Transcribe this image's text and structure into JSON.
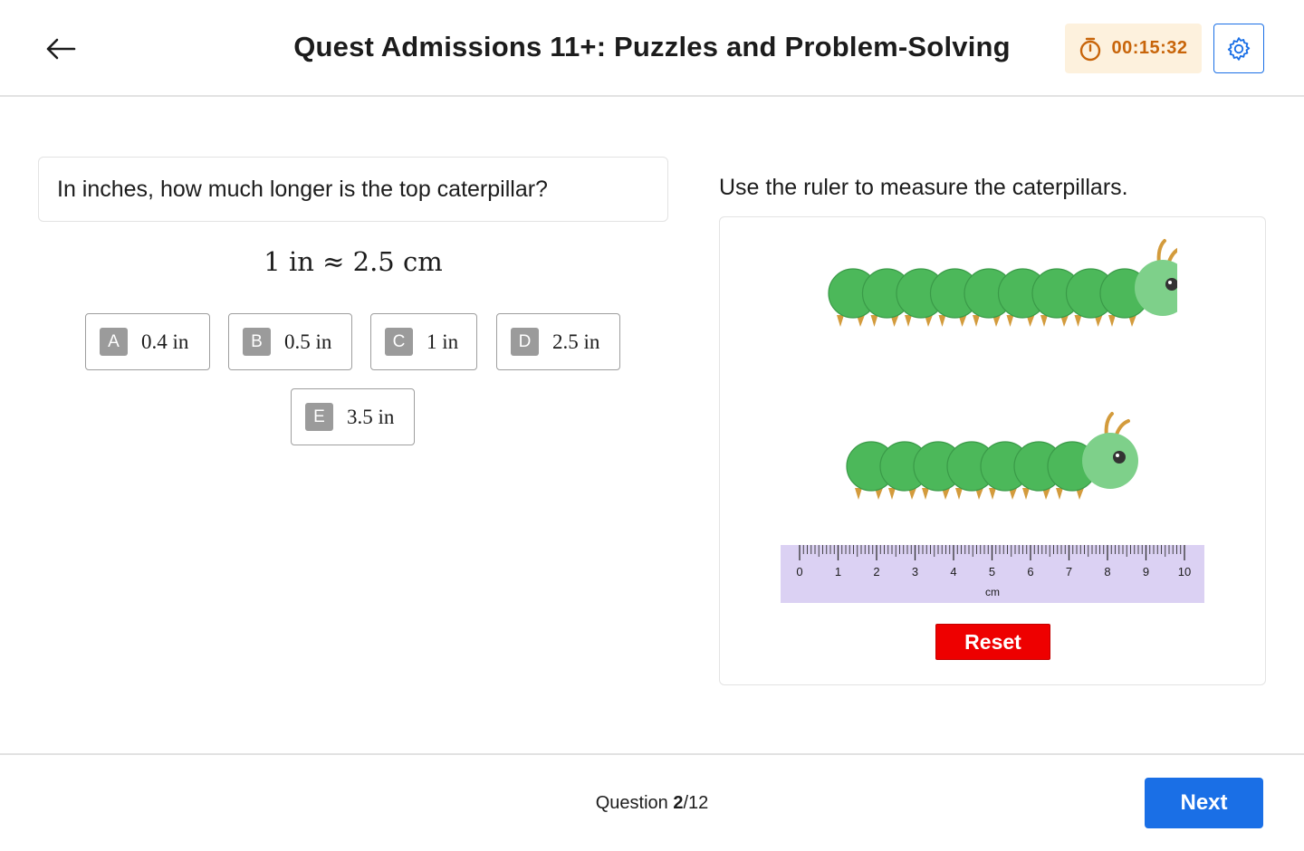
{
  "header": {
    "title": "Quest Admissions 11+: Puzzles and Problem-Solving",
    "timer": "00:15:32",
    "back_icon": "arrow-left-icon",
    "timer_icon": "stopwatch-icon",
    "settings_icon": "gear-icon"
  },
  "question": {
    "prompt": "In inches, how much longer is the top caterpillar?",
    "conversion": "1 in ≈ 2.5 cm",
    "options": [
      {
        "letter": "A",
        "text": "0.4 in"
      },
      {
        "letter": "B",
        "text": "0.5 in"
      },
      {
        "letter": "C",
        "text": "1 in"
      },
      {
        "letter": "D",
        "text": "2.5 in"
      },
      {
        "letter": "E",
        "text": "3.5 in"
      }
    ]
  },
  "tool": {
    "instructions": "Use the ruler to measure the caterpillars.",
    "ruler": {
      "labels": [
        "0",
        "1",
        "2",
        "3",
        "4",
        "5",
        "6",
        "7",
        "8",
        "9",
        "10"
      ],
      "unit": "cm"
    },
    "reset_label": "Reset"
  },
  "footer": {
    "progress_prefix": "Question ",
    "current": "2",
    "total_sep": "/12",
    "next_label": "Next"
  },
  "colors": {
    "primary": "#1a6fe6",
    "timer_bg": "#fdf1dd",
    "timer_text": "#c8650a",
    "reset": "#ee0000",
    "ruler": "#dbd1f3",
    "caterpillar_body": "#4cb85a",
    "caterpillar_head": "#7ed08a"
  }
}
